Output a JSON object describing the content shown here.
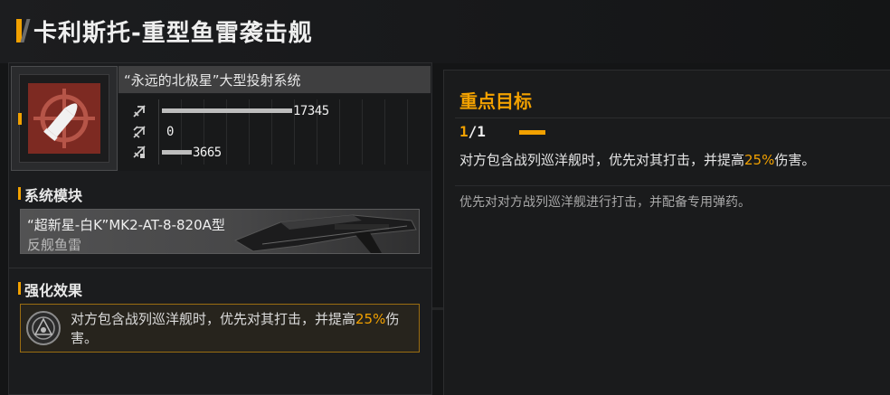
{
  "title": "卡利斯托-重型鱼雷袭击舰",
  "weapon": {
    "name": "“永远的北极星”大型投射系统",
    "icon": "ammo-target-icon",
    "stats": [
      {
        "icon": "anti-ship-icon",
        "value": "17345",
        "fill": 0.48
      },
      {
        "icon": "anti-aircraft-icon",
        "value": "0",
        "fill": 0.0
      },
      {
        "icon": "siege-icon",
        "value": "3665",
        "fill": 0.11
      }
    ]
  },
  "system_module": {
    "label": "系统模块",
    "name": "“超新星-白K”MK2-AT-8-820A型",
    "type": "反舰鱼雷"
  },
  "enhancement": {
    "label": "强化效果",
    "text_before": "对方包含战列巡洋舰时，优先对其打击，并提高",
    "highlight": "25%",
    "text_after": "伤害。"
  },
  "priority": {
    "title": "重点目标",
    "page_current": "1",
    "page_total": "/1",
    "desc_before": "对方包含战列巡洋舰时，优先对其打击，并提高",
    "desc_highlight": "25%",
    "desc_after": "伤害。",
    "note": "优先对对方战列巡洋舰进行打击，并配备专用弹药。"
  },
  "colors": {
    "accent": "#f2a100",
    "icon_red": "#7d2a22"
  }
}
